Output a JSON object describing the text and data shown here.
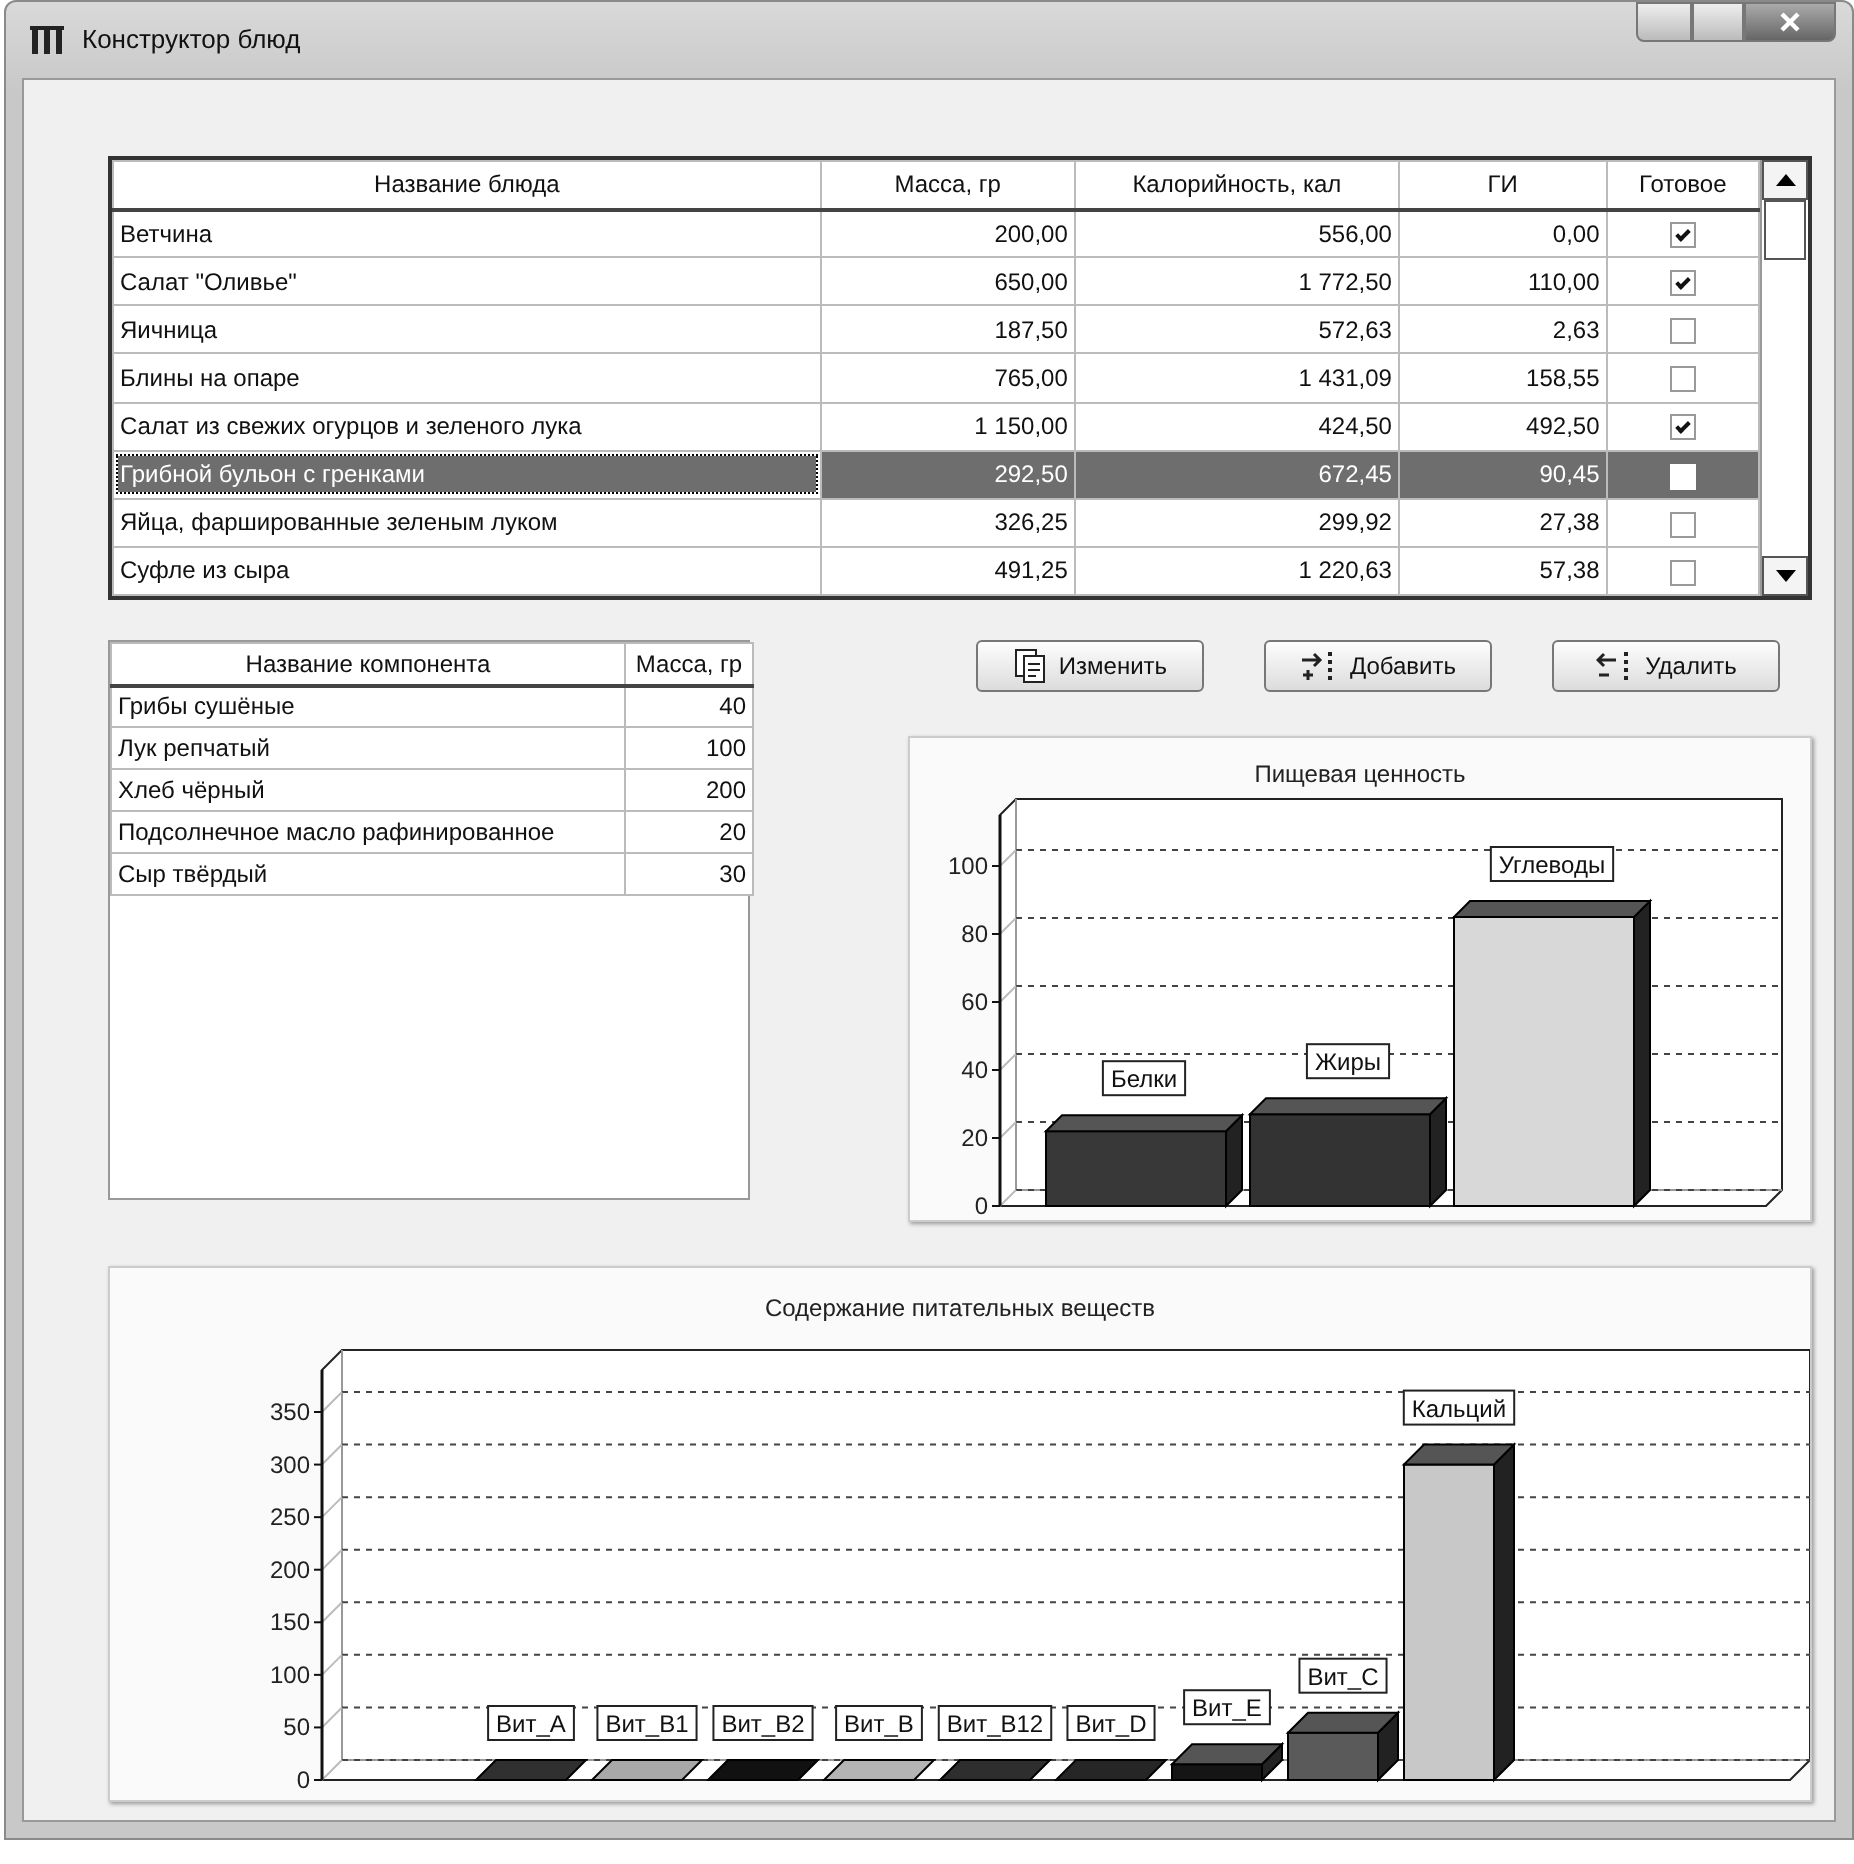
{
  "window": {
    "title": "Конструктор блюд"
  },
  "dishes": {
    "columns": [
      "Название блюда",
      "Масса, гр",
      "Калорийность, кал",
      "ГИ",
      "Готовое"
    ],
    "rows": [
      {
        "name": "Ветчина",
        "mass": "200,00",
        "calories": "556,00",
        "gi": "0,00",
        "ready": true,
        "selected": false
      },
      {
        "name": "Салат \"Оливье\"",
        "mass": "650,00",
        "calories": "1 772,50",
        "gi": "110,00",
        "ready": true,
        "selected": false
      },
      {
        "name": "Яичница",
        "mass": "187,50",
        "calories": "572,63",
        "gi": "2,63",
        "ready": false,
        "selected": false
      },
      {
        "name": "Блины на опаре",
        "mass": "765,00",
        "calories": "1 431,09",
        "gi": "158,55",
        "ready": false,
        "selected": false
      },
      {
        "name": "Салат из свежих огурцов и зеленого лука",
        "mass": "1 150,00",
        "calories": "424,50",
        "gi": "492,50",
        "ready": true,
        "selected": false
      },
      {
        "name": "Грибной бульон с гренками",
        "mass": "292,50",
        "calories": "672,45",
        "gi": "90,45",
        "ready": false,
        "selected": true
      },
      {
        "name": "Яйца, фаршированные зеленым луком",
        "mass": "326,25",
        "calories": "299,92",
        "gi": "27,38",
        "ready": false,
        "selected": false
      },
      {
        "name": "Суфле из сыра",
        "mass": "491,25",
        "calories": "1 220,63",
        "gi": "57,38",
        "ready": false,
        "selected": false
      }
    ]
  },
  "components": {
    "columns": [
      "Название компонента",
      "Масса, гр"
    ],
    "rows": [
      {
        "name": "Грибы сушёные",
        "mass": "40"
      },
      {
        "name": "Лук репчатый",
        "mass": "100"
      },
      {
        "name": "Хлеб чёрный",
        "mass": "200"
      },
      {
        "name": "Подсолнечное масло рафинированное",
        "mass": "20"
      },
      {
        "name": "Сыр твёрдый",
        "mass": "30"
      }
    ]
  },
  "buttons": [
    {
      "label": "Изменить",
      "kind": "edit"
    },
    {
      "label": "Добавить",
      "kind": "add"
    },
    {
      "label": "Удалить",
      "kind": "delete"
    }
  ],
  "nutrition_chart": {
    "chart_data": {
      "type": "bar",
      "title": "Пищевая ценность",
      "categories": [
        "Белки",
        "Жиры",
        "Углеводы"
      ],
      "values": [
        22,
        27,
        85
      ],
      "ylim": [
        0,
        115
      ],
      "yticks": [
        0,
        20,
        40,
        60,
        80,
        100
      ]
    }
  },
  "nutrients_chart": {
    "chart_data": {
      "type": "bar",
      "title": "Содержание питательных веществ",
      "categories": [
        "Вит_A",
        "Вит_B1",
        "Вит_B2",
        "Вит_B",
        "Вит_B12",
        "Вит_D",
        "Вит_E",
        "Вит_C",
        "Кальций"
      ],
      "values": [
        0,
        0,
        0,
        0,
        0,
        0,
        15,
        45,
        300
      ],
      "ylim": [
        0,
        390
      ],
      "yticks": [
        0,
        50,
        100,
        150,
        200,
        250,
        300,
        350
      ]
    }
  }
}
